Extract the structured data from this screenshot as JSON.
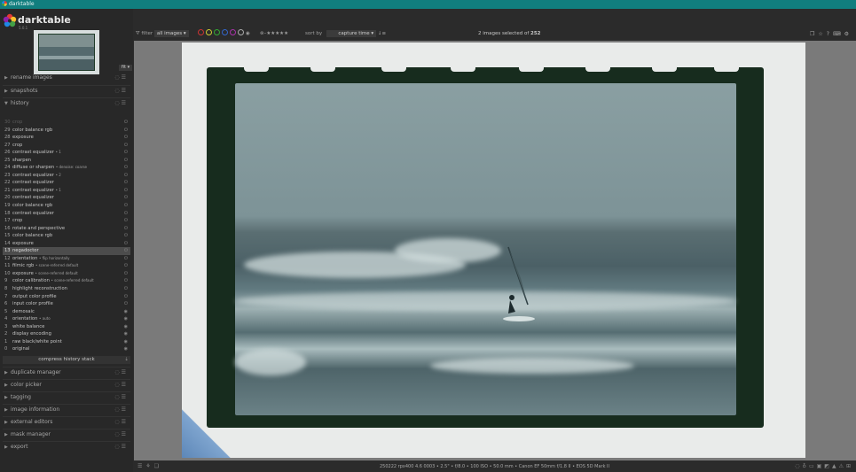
{
  "window": {
    "title": "darktable"
  },
  "logo": {
    "name": "darktable",
    "version": "5.0.1"
  },
  "zoom": {
    "value": "fit"
  },
  "modules_top": [
    {
      "label": "rename images",
      "expanded": false
    },
    {
      "label": "snapshots",
      "expanded": false
    },
    {
      "label": "history",
      "expanded": true
    }
  ],
  "history": [
    {
      "num": "30",
      "label": "crop",
      "mult": "",
      "state": "dim"
    },
    {
      "num": "29",
      "label": "color balance rgb",
      "mult": ""
    },
    {
      "num": "28",
      "label": "exposure",
      "mult": ""
    },
    {
      "num": "27",
      "label": "crop",
      "mult": ""
    },
    {
      "num": "26",
      "label": "contrast equalizer",
      "mult": "• 1"
    },
    {
      "num": "25",
      "label": "sharpen",
      "mult": ""
    },
    {
      "num": "24",
      "label": "diffuse or sharpen",
      "mult": "• denoise: coarse"
    },
    {
      "num": "23",
      "label": "contrast equalizer",
      "mult": "• 2"
    },
    {
      "num": "22",
      "label": "contrast equalizer",
      "mult": ""
    },
    {
      "num": "21",
      "label": "contrast equalizer",
      "mult": "• 1"
    },
    {
      "num": "20",
      "label": "contrast equalizer",
      "mult": ""
    },
    {
      "num": "19",
      "label": "color balance rgb",
      "mult": ""
    },
    {
      "num": "18",
      "label": "contrast equalizer",
      "mult": ""
    },
    {
      "num": "17",
      "label": "crop",
      "mult": ""
    },
    {
      "num": "16",
      "label": "rotate and perspective",
      "mult": ""
    },
    {
      "num": "15",
      "label": "color balance rgb",
      "mult": ""
    },
    {
      "num": "14",
      "label": "exposure",
      "mult": ""
    },
    {
      "num": "13",
      "label": "negadoctor",
      "mult": "",
      "state": "selected"
    },
    {
      "num": "12",
      "label": "orientation",
      "mult": "• flip horizontally"
    },
    {
      "num": "11",
      "label": "filmic rgb",
      "mult": "• scene-referred default"
    },
    {
      "num": "10",
      "label": "exposure",
      "mult": "• scene-referred default"
    },
    {
      "num": "9",
      "label": "color calibration",
      "mult": "• scene-referred default"
    },
    {
      "num": "8",
      "label": "highlight reconstruction",
      "mult": ""
    },
    {
      "num": "7",
      "label": "output color profile",
      "mult": ""
    },
    {
      "num": "6",
      "label": "input color profile",
      "mult": ""
    },
    {
      "num": "5",
      "label": "demosaic",
      "mult": ""
    },
    {
      "num": "4",
      "label": "orientation",
      "mult": "• auto"
    },
    {
      "num": "3",
      "label": "white balance",
      "mult": ""
    },
    {
      "num": "2",
      "label": "display encoding",
      "mult": ""
    },
    {
      "num": "1",
      "label": "raw black/white point",
      "mult": ""
    },
    {
      "num": "0",
      "label": "original",
      "mult": ""
    }
  ],
  "compress_label": "compress history stack",
  "modules_bottom": [
    {
      "label": "duplicate manager"
    },
    {
      "label": "color picker"
    },
    {
      "label": "tagging"
    },
    {
      "label": "image information"
    },
    {
      "label": "external editors"
    },
    {
      "label": "mask manager"
    },
    {
      "label": "export"
    }
  ],
  "toolbar": {
    "filter_label": "filter",
    "filter_value": "all images",
    "sort_label": "sort by",
    "sort_value": "capture time",
    "selection_prefix": "2 images selected of",
    "selection_total": "252"
  },
  "label_colors": [
    "#cc3333",
    "#cccc33",
    "#33aa33",
    "#3366cc",
    "#aa33aa",
    "#aaaaaa"
  ],
  "rating_stars": "★★★★★",
  "footer": {
    "image_info": "250222 rpx400 4.6 0003 • 2.5\" • f/8.0 • 100 ISO • 50.0 mm • Canon EF 50mm f/1.8 II • EOS 5D Mark II"
  }
}
